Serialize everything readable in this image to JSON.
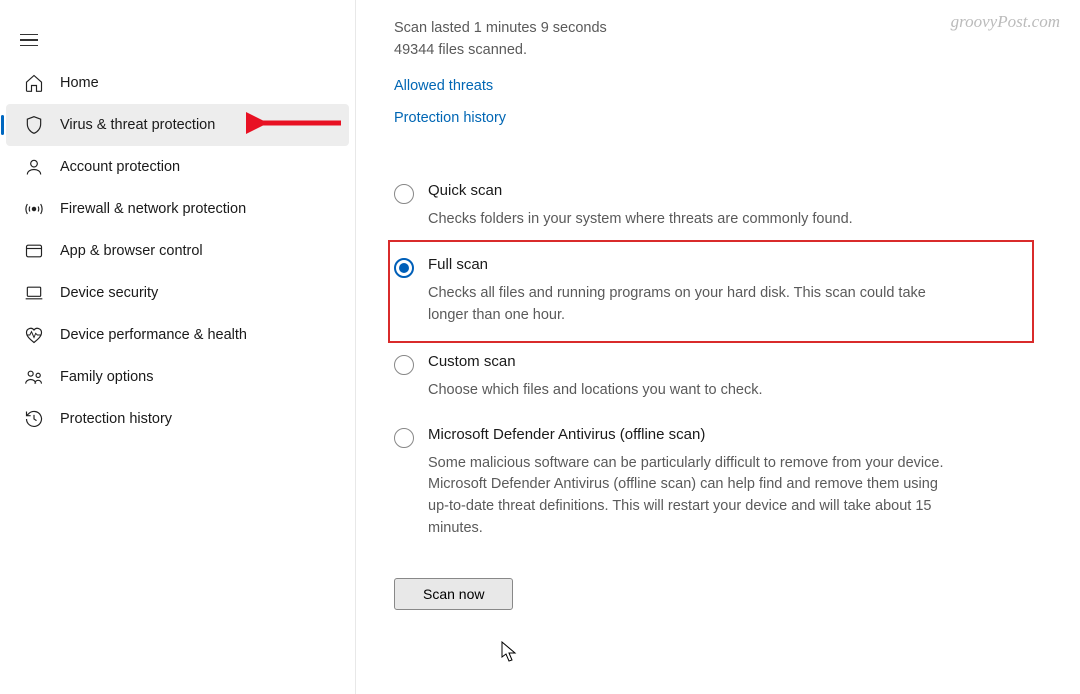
{
  "watermark": "groovyPost.com",
  "sidebar": {
    "items": [
      {
        "id": "home",
        "label": "Home"
      },
      {
        "id": "virus",
        "label": "Virus & threat protection"
      },
      {
        "id": "account",
        "label": "Account protection"
      },
      {
        "id": "firewall",
        "label": "Firewall & network protection"
      },
      {
        "id": "appbrowser",
        "label": "App & browser control"
      },
      {
        "id": "devicesec",
        "label": "Device security"
      },
      {
        "id": "devperf",
        "label": "Device performance & health"
      },
      {
        "id": "family",
        "label": "Family options"
      },
      {
        "id": "history",
        "label": "Protection history"
      }
    ]
  },
  "main": {
    "scan_info_1": "Scan lasted 1 minutes 9 seconds",
    "scan_info_2": "49344 files scanned.",
    "allowed_link": "Allowed threats",
    "history_link": "Protection history",
    "options": {
      "quick": {
        "title": "Quick scan",
        "desc": "Checks folders in your system where threats are commonly found."
      },
      "full": {
        "title": "Full scan",
        "desc": "Checks all files and running programs on your hard disk. This scan could take longer than one hour."
      },
      "custom": {
        "title": "Custom scan",
        "desc": "Choose which files and locations you want to check."
      },
      "offline": {
        "title": "Microsoft Defender Antivirus (offline scan)",
        "desc": "Some malicious software can be particularly difficult to remove from your device. Microsoft Defender Antivirus (offline scan) can help find and remove them using up-to-date threat definitions. This will restart your device and will take about 15 minutes."
      }
    },
    "scan_button": "Scan now"
  }
}
